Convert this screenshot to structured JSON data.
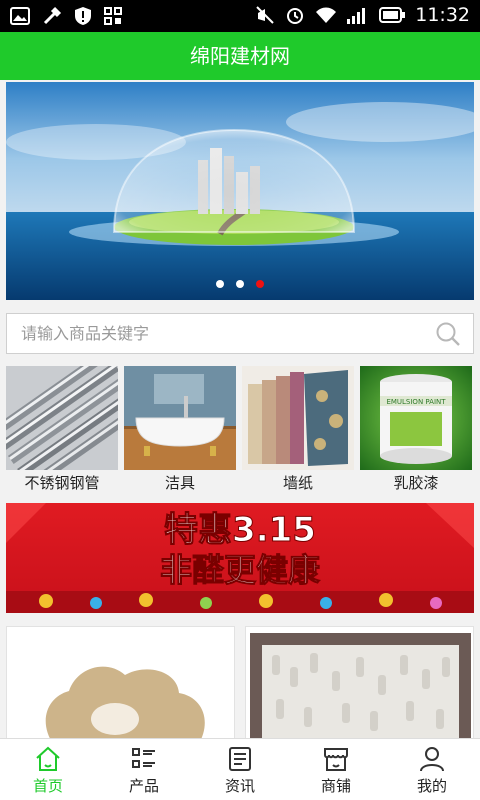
{
  "status_bar": {
    "time": "11:32"
  },
  "header": {
    "title": "绵阳建材网"
  },
  "banner": {
    "dots": 3,
    "active_dot": 3
  },
  "search": {
    "placeholder": "请输入商品关键字"
  },
  "categories": [
    {
      "label": "不锈钢钢管"
    },
    {
      "label": "洁具"
    },
    {
      "label": "墙纸"
    },
    {
      "label": "乳胶漆"
    }
  ],
  "promo": {
    "line1": "特惠3.15",
    "line2": "非醛更健康"
  },
  "bottom_nav": [
    {
      "label": "首页",
      "icon": "home-icon",
      "active": true
    },
    {
      "label": "产品",
      "icon": "list-icon",
      "active": false
    },
    {
      "label": "资讯",
      "icon": "news-icon",
      "active": false
    },
    {
      "label": "商铺",
      "icon": "shop-icon",
      "active": false
    },
    {
      "label": "我的",
      "icon": "user-icon",
      "active": false
    }
  ],
  "colors": {
    "accent": "#1fca2b",
    "active_dot": "#e11111",
    "promo_red": "#d9141b"
  }
}
